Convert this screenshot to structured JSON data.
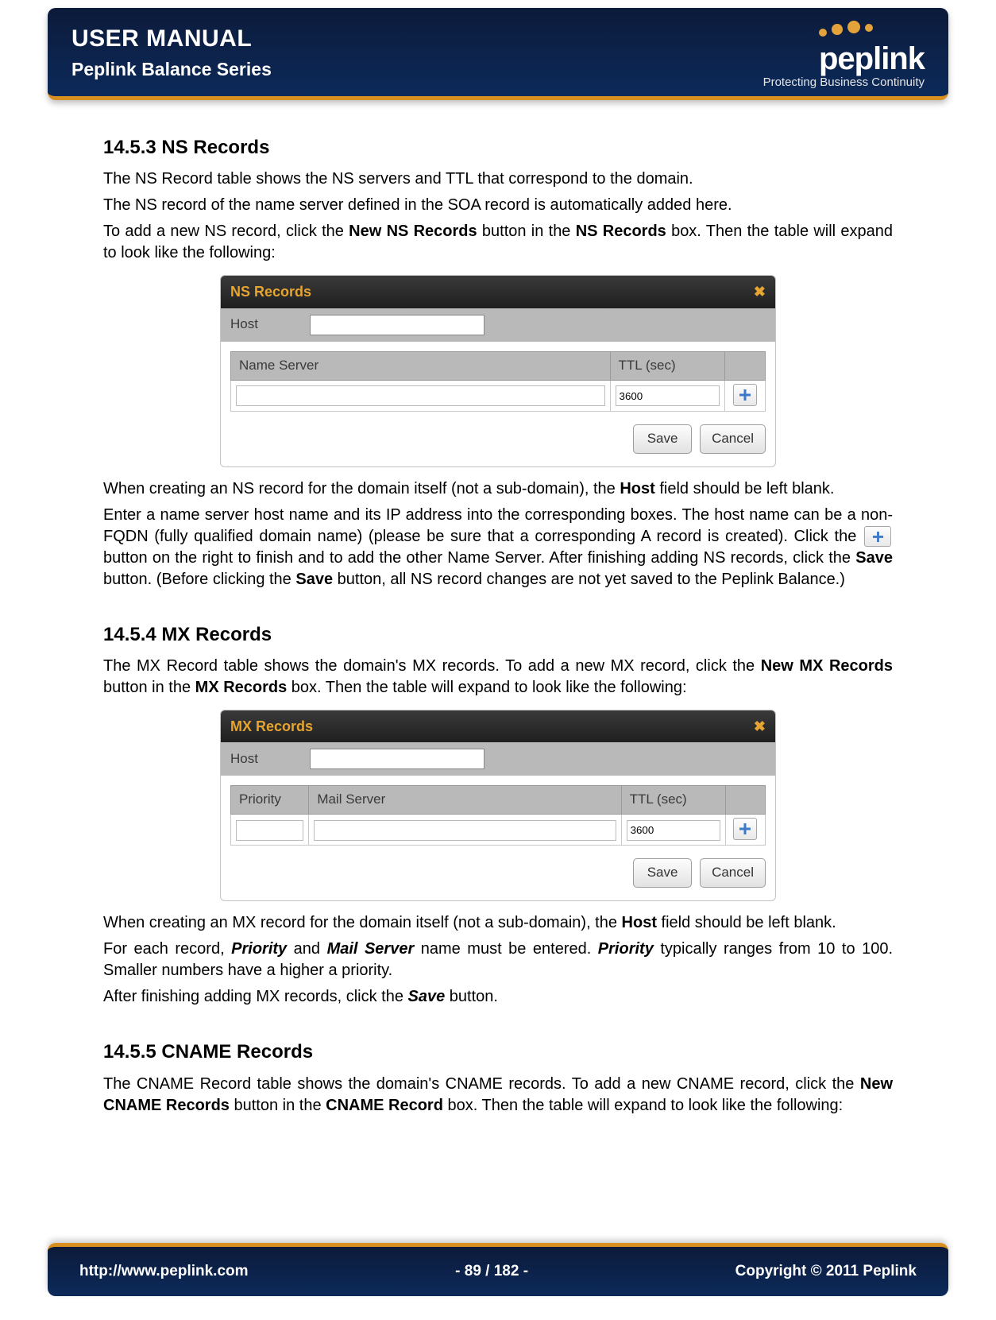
{
  "header": {
    "title": "USER MANUAL",
    "subtitle": "Peplink Balance Series",
    "brand": "peplink",
    "tagline": "Protecting Business Continuity"
  },
  "sections": {
    "ns": {
      "heading": "14.5.3 NS Records",
      "p1": "The NS Record table shows the NS servers and TTL that correspond to the domain.",
      "p2": "The NS record of the name server defined in the SOA record is automatically added here.",
      "p3a": "To add a new NS record, click the ",
      "p3b": "New NS Records",
      "p3c": " button in the ",
      "p3d": "NS Records",
      "p3e": " box.  Then the table will expand to look like the following:",
      "p4a": "When creating an NS record for the domain itself (not a sub-domain), the ",
      "p4b": "Host",
      "p4c": " field should be left blank.",
      "p5": "Enter a name server host name and its IP address into the corresponding boxes.  The host name can be a non-FQDN (fully qualified domain name) (please be sure that a corresponding A record is created).  Click the ",
      "p5b": " button on the right to finish and to add the other Name Server.  After finishing adding NS records, click the ",
      "p5c": "Save",
      "p5d": " button.  (Before clicking the ",
      "p5e": "Save",
      "p5f": " button, all NS record changes are not yet saved to the Peplink Balance.)"
    },
    "mx": {
      "heading": "14.5.4 MX Records",
      "p1a": "The MX Record table shows the domain's MX records. To add a new MX record, click the ",
      "p1b": "New MX Records",
      "p1c": " button in the ",
      "p1d": "MX Records",
      "p1e": " box.  Then the table will expand to look like the following:",
      "p2a": "When creating an MX record for the domain itself (not a sub-domain), the ",
      "p2b": "Host",
      "p2c": " field should be left blank.",
      "p3a": "For each record, ",
      "p3b": "Priority",
      "p3c": " and ",
      "p3d": "Mail Server",
      "p3e": " name must be entered.  ",
      "p3f": "Priority",
      "p3g": " typically ranges from 10 to 100.  Smaller numbers have a higher a priority.",
      "p4a": "After finishing adding MX records, click the ",
      "p4b": "Save",
      "p4c": " button."
    },
    "cname": {
      "heading": "14.5.5 CNAME Records",
      "p1a": "The CNAME Record table shows the domain's CNAME records. To add a new CNAME record, click the ",
      "p1b": "New CNAME Records",
      "p1c": " button in the ",
      "p1d": "CNAME Record",
      "p1e": " box.  Then the table will expand to look like the following:"
    }
  },
  "ns_panel": {
    "title": "NS Records",
    "host_label": "Host",
    "col_name": "Name Server",
    "col_ttl": "TTL (sec)",
    "ttl_default": "3600",
    "save": "Save",
    "cancel": "Cancel"
  },
  "mx_panel": {
    "title": "MX Records",
    "host_label": "Host",
    "col_priority": "Priority",
    "col_mail": "Mail Server",
    "col_ttl": "TTL (sec)",
    "ttl_default": "3600",
    "save": "Save",
    "cancel": "Cancel"
  },
  "footer": {
    "url": "http://www.peplink.com",
    "page": "- 89 / 182 -",
    "copyright": "Copyright © 2011 Peplink"
  }
}
